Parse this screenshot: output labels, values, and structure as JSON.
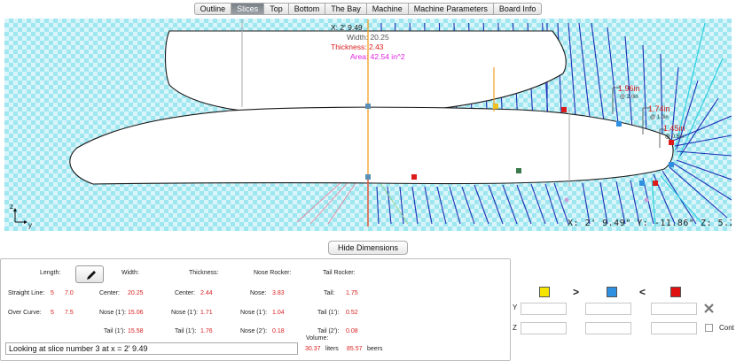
{
  "tabs": [
    {
      "label": "Outline",
      "active": false
    },
    {
      "label": "Slices",
      "active": true
    },
    {
      "label": "Top",
      "active": false
    },
    {
      "label": "Bottom",
      "active": false
    },
    {
      "label": "The Bay",
      "active": false
    },
    {
      "label": "Machine",
      "active": false
    },
    {
      "label": "Machine Parameters",
      "active": false
    },
    {
      "label": "Board Info",
      "active": false
    }
  ],
  "slice_info": {
    "x": "X: 2' 9.49",
    "width": "Width: 20.25",
    "thickness": "Thickness: 2.43",
    "area": "Area: 42.54 in^2"
  },
  "annotations": {
    "dim1": "1.96in",
    "dim1_sub": "@ 2.0in",
    "dim2": "1.74in",
    "dim2_sub": "@ 1.0in",
    "dim3": "1.45in",
    "dim3_sub": "@ 0.5in"
  },
  "axes": {
    "z": "z",
    "y": "y"
  },
  "coords": "X:  2' 9.49\"  Y: -11.86\"  Z:  5.2",
  "hide_dimensions_label": "Hide Dimensions",
  "dimensions": {
    "length_label": "Length:",
    "width_label": "Width:",
    "thickness_label": "Thickness:",
    "nose_rocker_label": "Nose Rocker:",
    "tail_rocker_label": "Tail Rocker:",
    "straight_line_label": "Straight Line:",
    "straight_line_ft": "5",
    "straight_line_in": "7.0",
    "over_curve_label": "Over Curve:",
    "over_curve_ft": "5",
    "over_curve_in": "7.5",
    "width_center_label": "Center:",
    "width_center": "20.25",
    "width_nose_label": "Nose (1'):",
    "width_nose": "15.06",
    "width_tail_label": "Tail (1'):",
    "width_tail": "15.58",
    "thick_center_label": "Center:",
    "thick_center": "2.44",
    "thick_nose_label": "Nose (1'):",
    "thick_nose": "1.71",
    "thick_tail_label": "Tail (1'):",
    "thick_tail": "1.76",
    "nose_label": "Nose:",
    "nose": "3.83",
    "nose1_label": "Nose (1'):",
    "nose1": "1.04",
    "nose2_label": "Nose (2'):",
    "nose2": "0.18",
    "tail_label": "Tail:",
    "tail": "1.75",
    "tail1_label": "Tail (1'):",
    "tail1": "0.52",
    "tail2_label": "Tail (2'):",
    "tail2": "0.08",
    "volume_label": "Volume:",
    "volume_liters": "30.37",
    "liters_label": "liters",
    "volume_beers": "85.57",
    "beers_label": "beers",
    "status": "Looking at slice number 3 at x = 2' 9.49"
  },
  "right_panel": {
    "arrow_right": ">",
    "arrow_left": "<",
    "y_label": "Y",
    "z_label": "Z",
    "cont_label": "Cont",
    "swatch_colors": [
      "#f4e400",
      "#2f8fe0",
      "#e01010"
    ]
  }
}
